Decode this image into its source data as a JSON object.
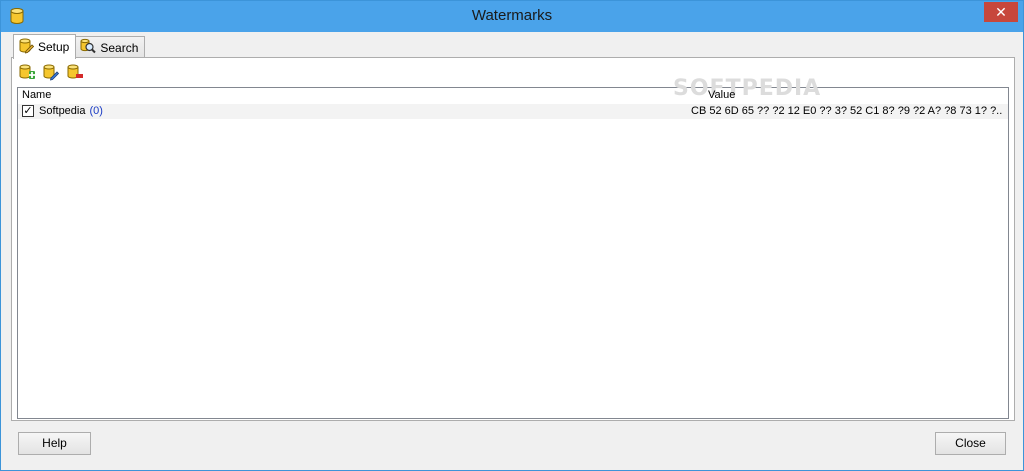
{
  "window": {
    "title": "Watermarks",
    "close_glyph": "✕"
  },
  "tabs": [
    {
      "label": "Setup",
      "icon": "database-edit-icon",
      "active": true
    },
    {
      "label": "Search",
      "icon": "search-icon",
      "active": false
    }
  ],
  "toolbar": {
    "items": [
      {
        "icon": "add-watermark-icon"
      },
      {
        "icon": "edit-watermark-icon"
      },
      {
        "icon": "delete-watermark-icon"
      }
    ]
  },
  "list": {
    "columns": {
      "name": "Name",
      "value": "Value"
    },
    "rows": [
      {
        "checked": true,
        "check_glyph": "✓",
        "name": "Softpedia",
        "count": "(0)",
        "value": "CB 52 6D 65 ?? ?2 12 E0 ?? 3? 52 C1 8? ?9 ?2 A? ?8 73 1? ?..."
      }
    ],
    "watermark_text": "SOFTPEDIA"
  },
  "buttons": {
    "help": "Help",
    "close": "Close"
  },
  "colors": {
    "titlebar": "#4aa3ea",
    "close_button": "#c7473c",
    "link_count": "#1a3bc4"
  }
}
